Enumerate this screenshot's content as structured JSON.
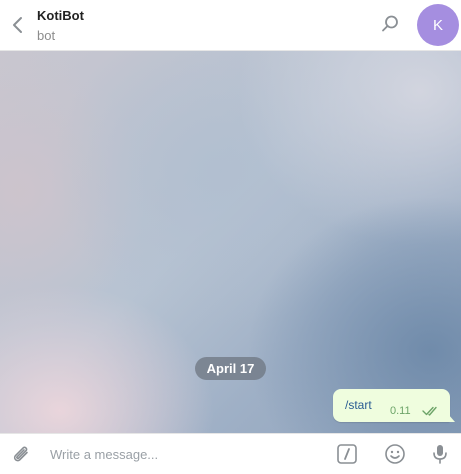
{
  "header": {
    "title": "KotiBot",
    "status": "bot",
    "avatar_letter": "K",
    "avatar_color": "#a58ee0"
  },
  "icons": {
    "back": "chevron-left-icon",
    "search": "search-icon",
    "attach": "paperclip-icon",
    "commands": "slash-command-icon",
    "emoji": "smiley-icon",
    "voice": "microphone-icon",
    "read_status": "double-check-icon"
  },
  "chat": {
    "date_separator": "April 17",
    "messages": [
      {
        "text": "/start",
        "time": "0.11",
        "outgoing": true,
        "status": "read"
      }
    ]
  },
  "composer": {
    "placeholder": "Write a message...",
    "value": ""
  },
  "colors": {
    "outgoing_bubble": "#effdde",
    "accent": "#2a5c93",
    "time_color": "#6da468",
    "icon_gray": "#8a8f94"
  }
}
